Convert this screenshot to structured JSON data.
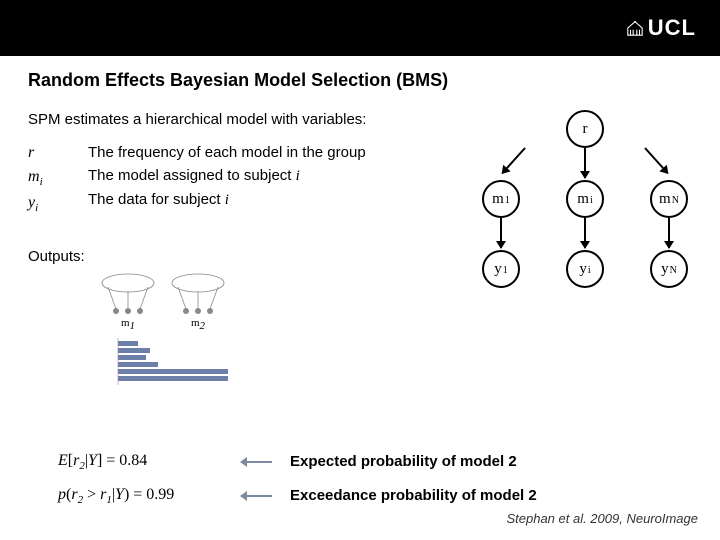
{
  "header": {
    "logo_text": "UCL"
  },
  "title": "Random Effects Bayesian Model Selection (BMS)",
  "subtitle": "SPM estimates a hierarchical model with variables:",
  "variables": [
    {
      "symbol": "r",
      "desc": "The frequency of each model in the group"
    },
    {
      "symbol": "mᵢ",
      "desc": "The model assigned to subject i"
    },
    {
      "symbol": "yᵢ",
      "desc": "The data for subject i"
    }
  ],
  "outputs_label": "Outputs:",
  "graph": {
    "top": "r",
    "mid": [
      "m₁",
      "mᵢ",
      "m_N"
    ],
    "bot": [
      "y₁",
      "yᵢ",
      "y_N"
    ]
  },
  "mini_models": {
    "left": "m₁",
    "right": "m₂"
  },
  "prob": [
    {
      "formula": "E[r₂|Y] = 0.84",
      "desc": "Expected probability of model 2"
    },
    {
      "formula": "p(r₂ > r₁|Y) = 0.99",
      "desc": "Exceedance probability of model 2"
    }
  ],
  "citation": "Stephan et al. 2009, NeuroImage"
}
